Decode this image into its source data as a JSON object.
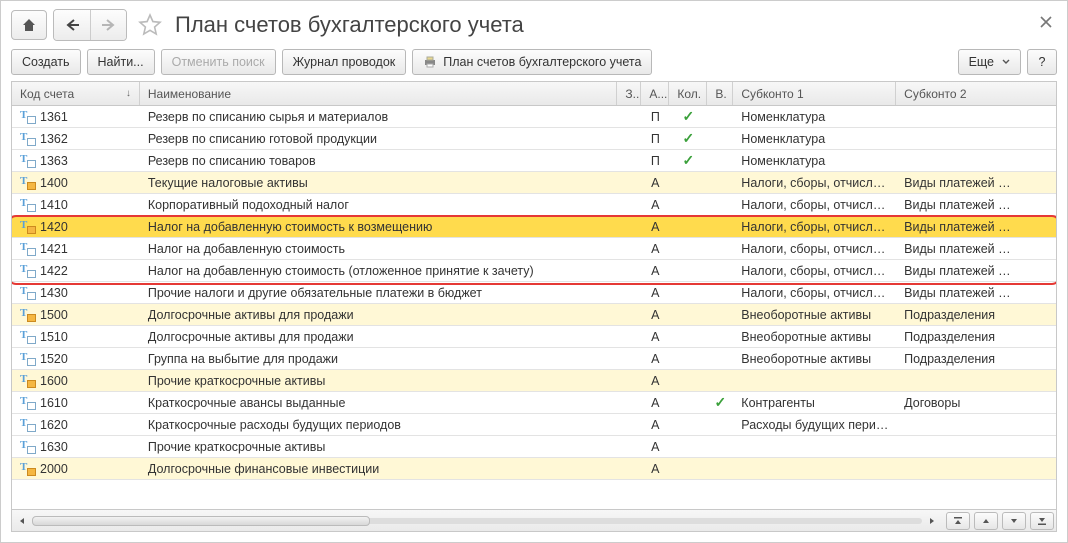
{
  "header": {
    "title": "План счетов бухгалтерского учета"
  },
  "toolbar": {
    "create": "Создать",
    "find": "Найти...",
    "cancel_search": "Отменить поиск",
    "journal": "Журнал проводок",
    "print_label": "План счетов бухгалтерского учета",
    "more": "Еще",
    "help": "?"
  },
  "columns": {
    "code": "Код счета",
    "name": "Наименование",
    "z": "З...",
    "a": "А...",
    "kol": "Кол.",
    "v": "В.",
    "sub1": "Субконто 1",
    "sub2": "Субконто 2"
  },
  "rows": [
    {
      "code": "1361",
      "type": "leaf",
      "name": "Резерв по списанию сырья и материалов",
      "a": "П",
      "kol": true,
      "sub1": "Номенклатура"
    },
    {
      "code": "1362",
      "type": "leaf",
      "name": "Резерв по списанию готовой продукции",
      "a": "П",
      "kol": true,
      "sub1": "Номенклатура"
    },
    {
      "code": "1363",
      "type": "leaf",
      "name": "Резерв по списанию товаров",
      "a": "П",
      "kol": true,
      "sub1": "Номенклатура"
    },
    {
      "code": "1400",
      "type": "group",
      "name": "Текущие налоговые активы",
      "a": "А",
      "sub1": "Налоги, сборы, отчисл…",
      "sub2": "Виды платежей …",
      "bg": "yellow"
    },
    {
      "code": "1410",
      "type": "leaf",
      "name": "Корпоративный подоходный налог",
      "a": "А",
      "sub1": "Налоги, сборы, отчисл…",
      "sub2": "Виды платежей …"
    },
    {
      "code": "1420",
      "type": "group",
      "name": "Налог на добавленную стоимость к возмещению",
      "a": "А",
      "sub1": "Налоги, сборы, отчисл…",
      "sub2": "Виды платежей …",
      "bg": "selected"
    },
    {
      "code": "1421",
      "type": "leaf",
      "name": "Налог на добавленную стоимость",
      "a": "А",
      "sub1": "Налоги, сборы, отчисл…",
      "sub2": "Виды платежей …"
    },
    {
      "code": "1422",
      "type": "leaf",
      "name": "Налог на добавленную стоимость (отложенное принятие к зачету)",
      "a": "А",
      "sub1": "Налоги, сборы, отчисл…",
      "sub2": "Виды платежей …"
    },
    {
      "code": "1430",
      "type": "leaf",
      "name": "Прочие налоги и другие обязательные платежи в бюджет",
      "a": "А",
      "sub1": "Налоги, сборы, отчисл…",
      "sub2": "Виды платежей …"
    },
    {
      "code": "1500",
      "type": "group",
      "name": "Долгосрочные активы для продажи",
      "a": "А",
      "sub1": "Внеоборотные активы",
      "sub2": "Подразделения",
      "bg": "yellow"
    },
    {
      "code": "1510",
      "type": "leaf",
      "name": "Долгосрочные активы для продажи",
      "a": "А",
      "sub1": "Внеоборотные активы",
      "sub2": "Подразделения"
    },
    {
      "code": "1520",
      "type": "leaf",
      "name": "Группа на выбытие для продажи",
      "a": "А",
      "sub1": "Внеоборотные активы",
      "sub2": "Подразделения"
    },
    {
      "code": "1600",
      "type": "group",
      "name": "Прочие краткосрочные активы",
      "a": "А",
      "bg": "yellow"
    },
    {
      "code": "1610",
      "type": "leaf",
      "name": "Краткосрочные авансы выданные",
      "a": "А",
      "v": true,
      "sub1": "Контрагенты",
      "sub2": "Договоры"
    },
    {
      "code": "1620",
      "type": "leaf",
      "name": "Краткосрочные расходы будущих периодов",
      "a": "А",
      "sub1": "Расходы будущих пери…"
    },
    {
      "code": "1630",
      "type": "leaf",
      "name": "Прочие краткосрочные активы",
      "a": "А"
    },
    {
      "code": "2000",
      "type": "group",
      "name": "Долгосрочные финансовые инвестиции",
      "a": "А",
      "bg": "yellow"
    }
  ]
}
